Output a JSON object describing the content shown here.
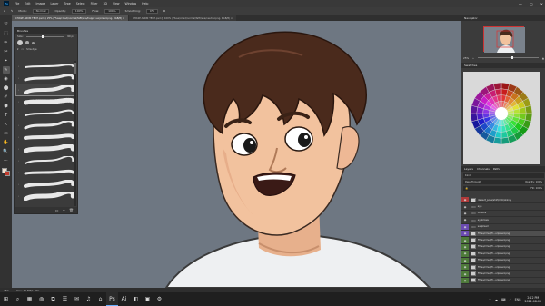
{
  "menubar": {
    "logo": "Ps",
    "items": [
      "File",
      "Edit",
      "Image",
      "Layer",
      "Type",
      "Select",
      "Filter",
      "3D",
      "View",
      "Window",
      "Help"
    ],
    "window_controls": [
      "—",
      "□",
      "✕"
    ]
  },
  "options": {
    "mode_label": "Mode:",
    "mode_value": "Normal",
    "opacity_label": "Opacity:",
    "opacity_value": "100%",
    "flow_label": "Flow:",
    "flow_value": "100%",
    "smoothing_label": "Smoothing:",
    "smoothing_value": "0%"
  },
  "tabs": [
    {
      "label": "CHASE ANON TECH.psd @ 25% (Ffusa/cmsd/normal/faftl/sna/happy surprised.png, RGB/8) ×",
      "active": true
    },
    {
      "label": "CHASE ANON TECH.psd @ 100% (Ffusa/cmsd/normal/faftl/sna/neutral.png, RGB/8) ×",
      "active": false
    }
  ],
  "tools": [
    "⤧",
    "⬚",
    "✑",
    "✂",
    "⌖",
    "✎",
    "◉",
    "⬤",
    "✐",
    "⬢",
    "T",
    "↖",
    "▭",
    "✋",
    "🔍",
    "⋯"
  ],
  "brush_panel": {
    "title": "Brushes",
    "size_label": "Size:",
    "size_value": "90 px",
    "group_label": "Smudge",
    "brushes_count": 12,
    "selected_index": 2
  },
  "navigator": {
    "title": "Navigator",
    "zoom": "25%"
  },
  "swatches": {
    "title": "Swatches"
  },
  "layers": {
    "title": "Layers",
    "tabs": [
      "Layers",
      "Channels",
      "Paths"
    ],
    "kind": "Kind",
    "blend": "Pass Through",
    "opacity_label": "Opacity:",
    "opacity": "100%",
    "fill_label": "Fill:",
    "fill": "100%",
    "items": [
      {
        "name": "default_pose/shirt/arm/skinny",
        "eye": "red",
        "type": "layer",
        "selected": false
      },
      {
        "name": "eye",
        "eye": "none",
        "type": "folder",
        "selected": false
      },
      {
        "name": "mouths",
        "eye": "none",
        "type": "folder",
        "selected": false
      },
      {
        "name": "eyebrows",
        "eye": "none",
        "type": "folder",
        "selected": false
      },
      {
        "name": "surprised",
        "eye": "purple",
        "type": "folder",
        "selected": false
      },
      {
        "name": "Ffusa/cmsd/fr...urprised.png",
        "eye": "purple",
        "type": "layer",
        "selected": true
      },
      {
        "name": "Ffusa/cmsd/fr...urprised.png",
        "eye": "green",
        "type": "layer",
        "selected": false
      },
      {
        "name": "Ffusa/cmsd/fr...urprised.png",
        "eye": "green",
        "type": "layer",
        "selected": false
      },
      {
        "name": "Ffusa/cmsd/fr...urprised.png",
        "eye": "green",
        "type": "layer",
        "selected": false
      },
      {
        "name": "Ffusa/cmsd/fr...urprised.png",
        "eye": "green",
        "type": "layer",
        "selected": false
      },
      {
        "name": "Ffusa/cmsd/fr...urprised.png",
        "eye": "green",
        "type": "layer",
        "selected": false
      },
      {
        "name": "Ffusa/cmsd/fr...urprised.png",
        "eye": "green",
        "type": "layer",
        "selected": false
      },
      {
        "name": "Ffusa/cmsd/fr...urprised.png",
        "eye": "green",
        "type": "layer",
        "selected": false
      }
    ]
  },
  "status": {
    "zoom": "25%",
    "doc": "Doc: 46.8M/1.39G"
  },
  "taskbar": {
    "apps": [
      "⊞",
      "⌕",
      "▦",
      "◍",
      "⧉",
      "☰",
      "✉",
      "♫",
      "⌂",
      "Ps",
      "Ai",
      "◧",
      "▣",
      "⚙"
    ],
    "active_index": 9,
    "tray": [
      "^",
      "☁",
      "⌨",
      "♪",
      "ENG"
    ],
    "time": "2:12 PM",
    "date": "2022-08-09"
  }
}
